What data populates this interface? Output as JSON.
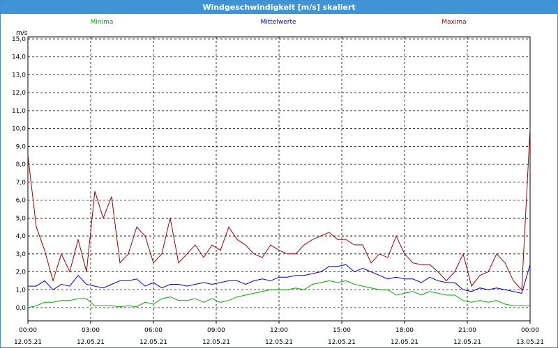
{
  "window": {
    "title": "Windgeschwindigkeit [m/s] skaliert"
  },
  "chart_data": {
    "type": "line",
    "title": "Windgeschwindigkeit [m/s] skaliert",
    "ylabel": "m/s",
    "ylim": [
      0,
      15
    ],
    "xlim": [
      "12.05.21 00:00",
      "13.05.21 00:00"
    ],
    "y_ticks": [
      "0,0",
      "1,0",
      "2,0",
      "3,0",
      "4,0",
      "5,0",
      "6,0",
      "7,0",
      "8,0",
      "9,0",
      "10,0",
      "11,0",
      "12,0",
      "13,0",
      "14,0",
      "15,0"
    ],
    "x_ticks": [
      {
        "time": "00:00",
        "date": "12.05.21"
      },
      {
        "time": "03:00",
        "date": "12.05.21"
      },
      {
        "time": "06:00",
        "date": "12.05.21"
      },
      {
        "time": "09:00",
        "date": "12.05.21"
      },
      {
        "time": "12:00",
        "date": "12.05.21"
      },
      {
        "time": "15:00",
        "date": "12.05.21"
      },
      {
        "time": "18:00",
        "date": "12.05.21"
      },
      {
        "time": "21:00",
        "date": "12.05.21"
      },
      {
        "time": "00:00",
        "date": "13.05.21"
      }
    ],
    "grid": true,
    "legend_position": "top",
    "x_hours": [
      0,
      0.4,
      0.8,
      1.2,
      1.6,
      2,
      2.4,
      2.8,
      3.2,
      3.6,
      4,
      4.4,
      4.8,
      5.2,
      5.6,
      6,
      6.4,
      6.8,
      7.2,
      7.6,
      8,
      8.4,
      8.8,
      9.2,
      9.6,
      10,
      10.4,
      10.8,
      11.2,
      11.6,
      12,
      12.4,
      12.8,
      13.2,
      13.6,
      14,
      14.4,
      14.8,
      15.2,
      15.6,
      16,
      16.4,
      16.8,
      17.2,
      17.6,
      18,
      18.4,
      18.8,
      19.2,
      19.6,
      20,
      20.4,
      20.8,
      21.2,
      21.6,
      22,
      22.4,
      22.8,
      23.2,
      23.6,
      24
    ],
    "series": [
      {
        "name": "Minima",
        "color": "#00aa00",
        "values": [
          0.0,
          0.1,
          0.3,
          0.3,
          0.4,
          0.4,
          0.5,
          0.5,
          0.1,
          0.1,
          0.1,
          0.05,
          0.1,
          0.05,
          0.3,
          0.2,
          0.5,
          0.6,
          0.4,
          0.4,
          0.5,
          0.3,
          0.5,
          0.3,
          0.4,
          0.6,
          0.7,
          0.8,
          0.9,
          1.0,
          1.0,
          1.0,
          1.1,
          1.0,
          1.3,
          1.4,
          1.5,
          1.4,
          1.5,
          1.3,
          1.2,
          1.1,
          1.0,
          1.0,
          0.7,
          0.8,
          0.9,
          0.7,
          0.9,
          0.8,
          0.7,
          0.7,
          0.4,
          0.3,
          0.4,
          0.3,
          0.4,
          0.2,
          0.1,
          0.1,
          0.1
        ]
      },
      {
        "name": "Mittelwerte",
        "color": "#0000cc",
        "values": [
          1.2,
          1.2,
          1.5,
          1.0,
          1.3,
          1.2,
          1.8,
          1.3,
          1.2,
          1.1,
          1.3,
          1.5,
          1.5,
          1.6,
          1.2,
          1.4,
          1.1,
          1.3,
          1.3,
          1.2,
          1.3,
          1.4,
          1.3,
          1.4,
          1.5,
          1.5,
          1.3,
          1.5,
          1.6,
          1.5,
          1.7,
          1.7,
          1.8,
          1.8,
          1.9,
          2.0,
          2.3,
          2.3,
          2.4,
          2.0,
          2.2,
          2.0,
          1.8,
          1.6,
          1.7,
          1.6,
          1.6,
          1.4,
          1.7,
          1.5,
          1.4,
          1.4,
          1.0,
          0.9,
          1.1,
          1.0,
          1.1,
          1.0,
          0.9,
          0.8,
          2.4
        ]
      },
      {
        "name": "Maxima",
        "color": "#990000",
        "values": [
          8.5,
          4.5,
          3.2,
          1.5,
          3.0,
          2.0,
          3.8,
          2.0,
          6.5,
          5.0,
          6.2,
          2.5,
          3.0,
          4.5,
          4.0,
          2.5,
          3.0,
          5.0,
          2.5,
          3.0,
          3.5,
          2.8,
          3.5,
          3.2,
          4.5,
          3.8,
          3.5,
          3.0,
          2.8,
          3.5,
          3.2,
          3.0,
          3.0,
          3.5,
          3.8,
          4.0,
          4.2,
          3.8,
          3.8,
          3.5,
          3.5,
          2.5,
          3.0,
          2.8,
          4.0,
          3.0,
          2.5,
          2.4,
          2.4,
          2.0,
          1.5,
          2.0,
          3.0,
          1.2,
          1.8,
          2.0,
          3.0,
          2.5,
          1.5,
          1.0,
          10.0
        ]
      }
    ]
  }
}
